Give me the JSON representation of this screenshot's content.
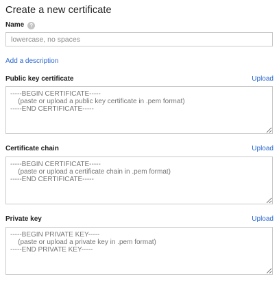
{
  "title": "Create a new certificate",
  "name_field": {
    "label": "Name",
    "help_icon": "help-icon",
    "placeholder": "lowercase, no spaces",
    "value": ""
  },
  "add_description_link": "Add a description",
  "public_key": {
    "label": "Public key certificate",
    "upload_label": "Upload",
    "placeholder": "-----BEGIN CERTIFICATE-----\n    (paste or upload a public key certificate in .pem format)\n-----END CERTIFICATE-----"
  },
  "certificate_chain": {
    "label": "Certificate chain",
    "upload_label": "Upload",
    "placeholder": "-----BEGIN CERTIFICATE-----\n    (paste or upload a certificate chain in .pem format)\n-----END CERTIFICATE-----"
  },
  "private_key": {
    "label": "Private key",
    "upload_label": "Upload",
    "placeholder": "-----BEGIN PRIVATE KEY-----\n    (paste or upload a private key in .pem format)\n-----END PRIVATE KEY-----"
  },
  "colors": {
    "link": "#2a67d1",
    "border": "#c8c8c8",
    "placeholder": "#757575"
  }
}
